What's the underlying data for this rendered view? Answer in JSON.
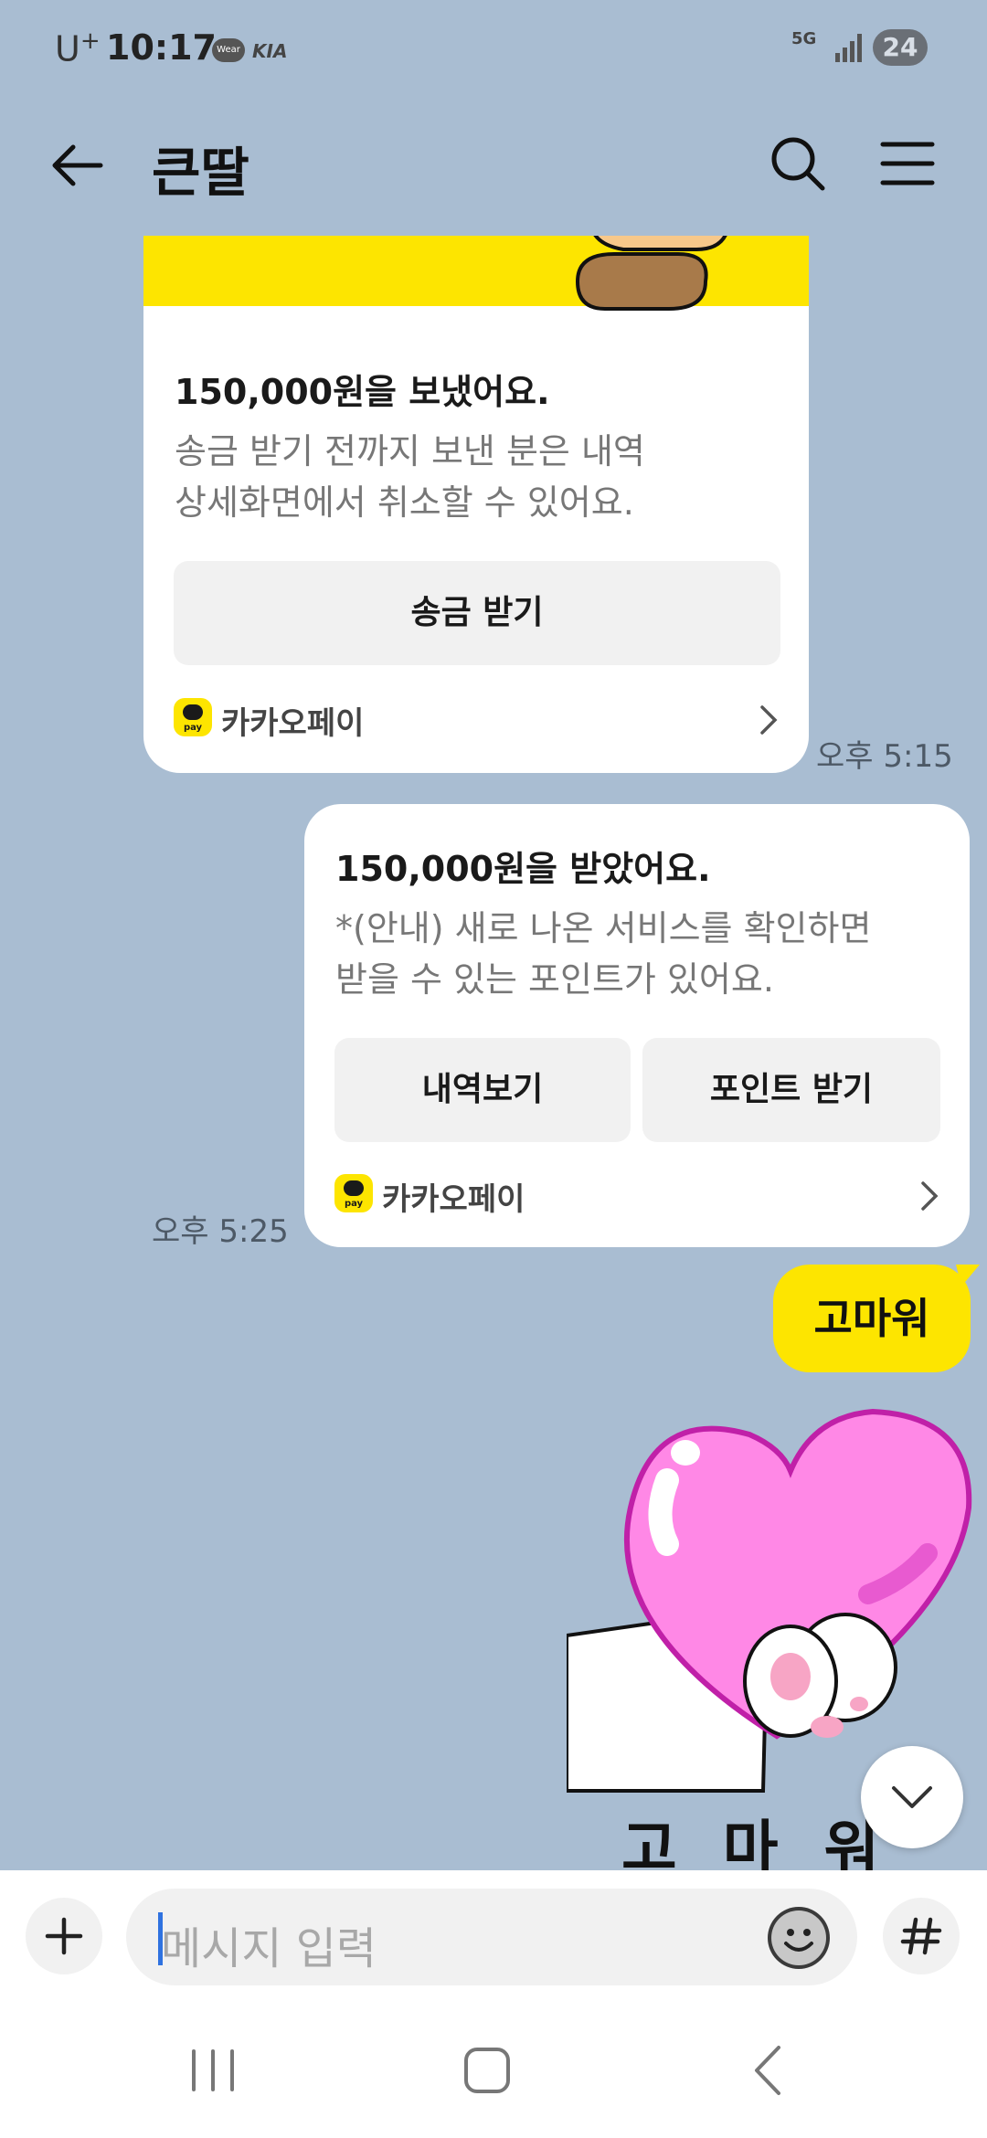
{
  "status_bar": {
    "carrier": "U",
    "carrier_sup": "+",
    "time": "10:17",
    "wear_badge": "Wear",
    "kia_badge": "KIA",
    "network": "5G",
    "battery": "24"
  },
  "header": {
    "title": "큰딸"
  },
  "messages": {
    "card1": {
      "title": "150,000원을 보냈어요.",
      "desc_line1": "송금 받기 전까지 보낸 분은 내역",
      "desc_line2": "상세화면에서 취소할 수 있어요.",
      "button": "송금 받기",
      "provider": "카카오페이",
      "time": "오후 5:15"
    },
    "card2": {
      "title": "150,000원을 받았어요.",
      "desc_line1": "*(안내) 새로 나온 서비스를 확인하면",
      "desc_line2": "받을 수 있는 포인트가 있어요.",
      "button_left": "내역보기",
      "button_right": "포인트 받기",
      "provider": "카카오페이",
      "time": "오후 5:25"
    },
    "text_bubble": "고마워",
    "sticker_text": "고마워"
  },
  "pay_logo_text": "pay",
  "input": {
    "placeholder": "메시지 입력"
  },
  "colors": {
    "chat_background": "#a9bdd2",
    "kakao_yellow": "#fde500",
    "heart_pink": "#ff88e6"
  },
  "icons": [
    "back-arrow-icon",
    "search-icon",
    "menu-icon",
    "chevron-right-icon",
    "chevron-down-icon",
    "plus-icon",
    "emoji-icon",
    "hash-icon",
    "recent-apps-icon",
    "home-icon",
    "back-nav-icon"
  ]
}
